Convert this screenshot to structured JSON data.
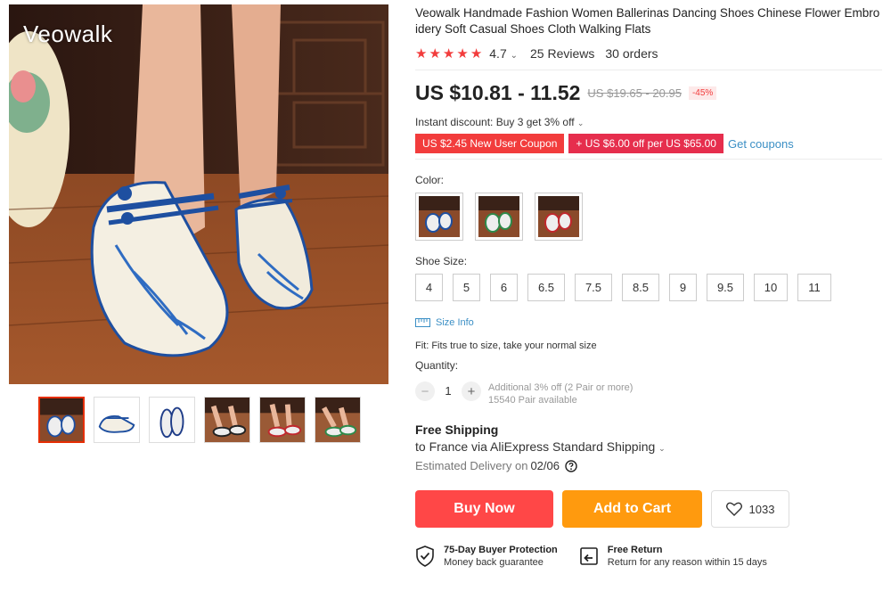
{
  "gallery": {
    "brand_mark": "Veowalk",
    "thumbnails": [
      "color-1",
      "side-view-blue",
      "pair-top-view",
      "worn-black",
      "worn-red",
      "worn-green"
    ],
    "active_index": 0
  },
  "product": {
    "title": "Veowalk Handmade Fashion Women Ballerinas Dancing Shoes Chinese Flower Embroidery Soft Casual Shoes Cloth Walking Flats",
    "rating_value": "4.7",
    "rating_stars": 5,
    "reviews": "25 Reviews",
    "orders": "30 orders"
  },
  "price": {
    "current": "US $10.81 - 11.52",
    "original": "US $19.65 - 20.95",
    "discount": "-45%"
  },
  "promotions": {
    "instant_discount": "Instant discount: Buy 3 get 3% off",
    "coupon_new_user": "US $2.45 New User Coupon",
    "coupon_store": "US $6.00 off per US $65.00",
    "get_coupons": "Get coupons"
  },
  "color": {
    "label": "Color:",
    "options": [
      "blue",
      "green",
      "red"
    ]
  },
  "shoe_size": {
    "label": "Shoe Size:",
    "options": [
      "4",
      "5",
      "6",
      "6.5",
      "7.5",
      "8.5",
      "9",
      "9.5",
      "10",
      "11"
    ],
    "size_info": "Size Info",
    "fit": "Fit: Fits true to size, take your normal size"
  },
  "quantity": {
    "label": "Quantity:",
    "value": "1",
    "minus": "−",
    "plus": "+",
    "note_discount": "Additional 3% off (2 Pair or more)",
    "note_available": "15540 Pair available"
  },
  "shipping": {
    "title": "Free Shipping",
    "destination": "to France via AliExpress Standard Shipping",
    "delivery_label": "Estimated Delivery on",
    "delivery_date": "02/06"
  },
  "actions": {
    "buy_now": "Buy Now",
    "add_to_cart": "Add to Cart",
    "wishlist_count": "1033"
  },
  "guarantees": {
    "protection_title": "75-Day Buyer Protection",
    "protection_sub": "Money back guarantee",
    "return_title": "Free Return",
    "return_sub": "Return for any reason within 15 days"
  },
  "colors": {
    "accent_red": "#ff4747",
    "accent_orange": "#ff9a0e",
    "link_blue": "#3b8fc5",
    "star_red": "#f23c3c"
  }
}
